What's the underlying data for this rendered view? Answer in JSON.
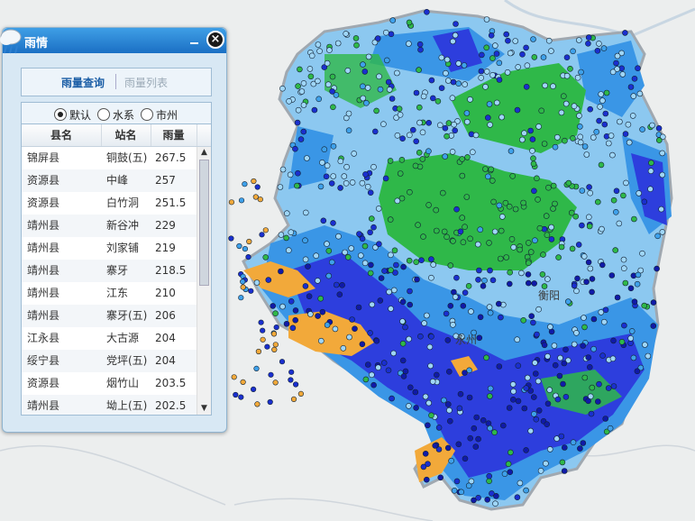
{
  "map": {
    "colors": {
      "land_bg": "#eceeee",
      "water": "#a7c5da",
      "rain_light": "#8cc8f0",
      "rain_medium": "#3a96e6",
      "rain_heavy": "#2d3edd",
      "rain_storm": "#f2a93a",
      "green_zone": "#2fb849",
      "boundary": "#9ca3ab"
    },
    "labels": [
      {
        "text": "衡阳"
      },
      {
        "text": "永州"
      }
    ]
  },
  "panel": {
    "title": "雨情",
    "minimize_icon": "minimize-icon",
    "close_icon": "close-icon",
    "tabs": [
      {
        "label": "雨量查询",
        "active": true
      },
      {
        "label": "雨量列表",
        "active": false
      }
    ],
    "radio_options": [
      {
        "label": "默认",
        "selected": true
      },
      {
        "label": "水系",
        "selected": false
      },
      {
        "label": "市州",
        "selected": false
      }
    ],
    "table": {
      "headers": [
        "县名",
        "站名",
        "雨量"
      ],
      "rows": [
        {
          "county": "锦屏县",
          "station": "铜鼓(五)",
          "rain": "267.5"
        },
        {
          "county": "资源县",
          "station": "中峰",
          "rain": "257"
        },
        {
          "county": "资源县",
          "station": "白竹洞",
          "rain": "251.5"
        },
        {
          "county": "靖州县",
          "station": "新谷冲",
          "rain": "229"
        },
        {
          "county": "靖州县",
          "station": "刘家铺",
          "rain": "219"
        },
        {
          "county": "靖州县",
          "station": "寨牙",
          "rain": "218.5"
        },
        {
          "county": "靖州县",
          "station": "江东",
          "rain": "210"
        },
        {
          "county": "靖州县",
          "station": "寨牙(五)",
          "rain": "206"
        },
        {
          "county": "江永县",
          "station": "大古源",
          "rain": "204"
        },
        {
          "county": "绥宁县",
          "station": "党坪(五)",
          "rain": "204"
        },
        {
          "county": "资源县",
          "station": "烟竹山",
          "rain": "203.5"
        },
        {
          "county": "靖州县",
          "station": "坳上(五)",
          "rain": "202.5"
        }
      ]
    }
  }
}
